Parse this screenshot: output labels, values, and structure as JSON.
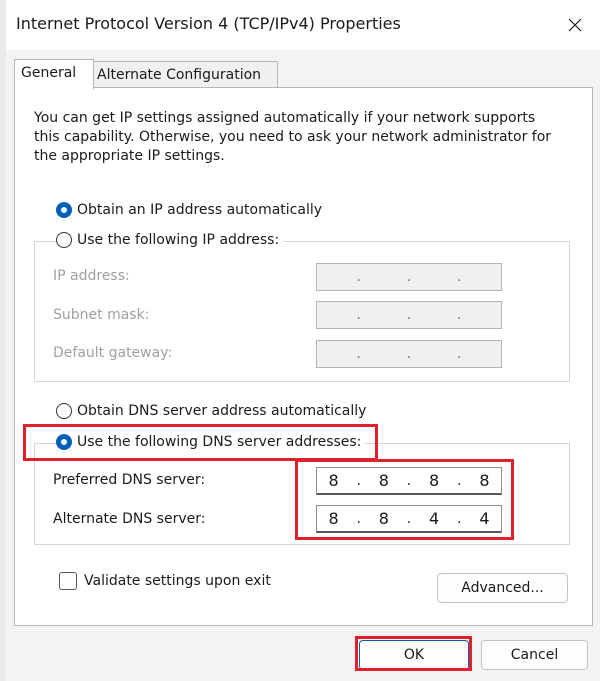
{
  "window": {
    "title": "Internet Protocol Version 4 (TCP/IPv4) Properties"
  },
  "tabs": [
    {
      "label": "General",
      "active": true
    },
    {
      "label": "Alternate Configuration",
      "active": false
    }
  ],
  "intro_text": "You can get IP settings assigned automatically if your network supports this capability. Otherwise, you need to ask your network administrator for the appropriate IP settings.",
  "ip": {
    "auto_label": "Obtain an IP address automatically",
    "manual_label": "Use the following IP address:",
    "selected": "auto",
    "fields": [
      {
        "label": "IP address:"
      },
      {
        "label": "Subnet mask:"
      },
      {
        "label": "Default gateway:"
      }
    ]
  },
  "dns": {
    "auto_label": "Obtain DNS server address automatically",
    "manual_label": "Use the following DNS server addresses:",
    "selected": "manual",
    "preferred_label": "Preferred DNS server:",
    "preferred_value": [
      "8",
      "8",
      "8",
      "8"
    ],
    "alternate_label": "Alternate DNS server:",
    "alternate_value": [
      "8",
      "8",
      "4",
      "4"
    ]
  },
  "validate_label": "Validate settings upon exit",
  "advanced_label": "Advanced...",
  "ok_label": "OK",
  "cancel_label": "Cancel",
  "colors": {
    "accent": "#005fb8",
    "highlight": "#e0202a"
  }
}
